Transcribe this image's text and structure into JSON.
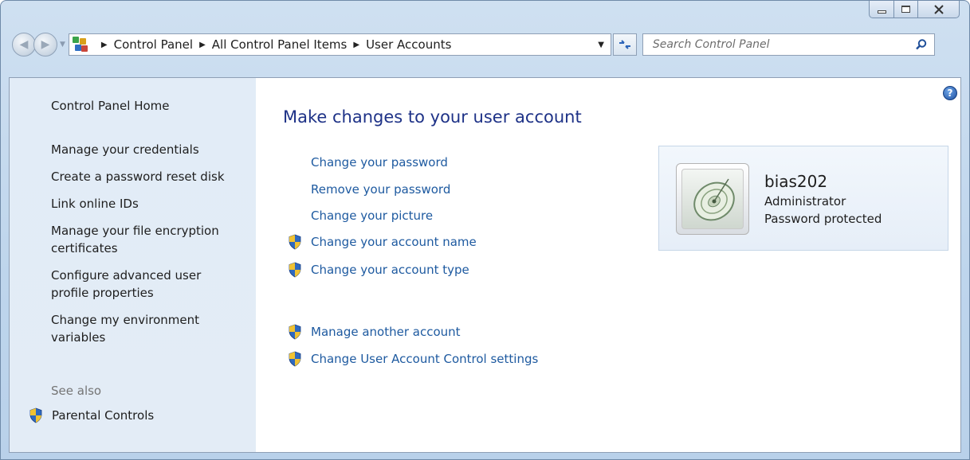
{
  "window": {
    "caption_buttons": [
      "minimize",
      "maximize",
      "close"
    ]
  },
  "address_bar": {
    "breadcrumbs": [
      "Control Panel",
      "All Control Panel Items",
      "User Accounts"
    ]
  },
  "search": {
    "placeholder": "Search Control Panel"
  },
  "sidebar": {
    "items": [
      {
        "label": "Control Panel Home"
      },
      {
        "label": "Manage your credentials"
      },
      {
        "label": "Create a password reset disk"
      },
      {
        "label": "Link online IDs"
      },
      {
        "label": "Manage your file encryption certificates"
      },
      {
        "label": "Configure advanced user profile properties"
      },
      {
        "label": "Change my environment variables"
      }
    ],
    "see_also_label": "See also",
    "see_also_items": [
      {
        "label": "Parental Controls",
        "icon": "uac-shield-icon"
      }
    ]
  },
  "main": {
    "heading": "Make changes to your user account",
    "tasks": [
      {
        "label": "Change your password",
        "shield": false
      },
      {
        "label": "Remove your password",
        "shield": false
      },
      {
        "label": "Change your picture",
        "shield": false
      },
      {
        "label": "Change your account name",
        "shield": true
      },
      {
        "label": "Change your account type",
        "shield": true
      }
    ],
    "other_tasks": [
      {
        "label": "Manage another account",
        "shield": true
      },
      {
        "label": "Change User Account Control settings",
        "shield": true
      }
    ]
  },
  "user": {
    "name": "bias202",
    "role": "Administrator",
    "status": "Password protected"
  },
  "colors": {
    "link": "#1e5aa0",
    "heading": "#1e3287",
    "sidebar_bg": "#e2ecf7",
    "window_frame": "#bed5ec"
  }
}
